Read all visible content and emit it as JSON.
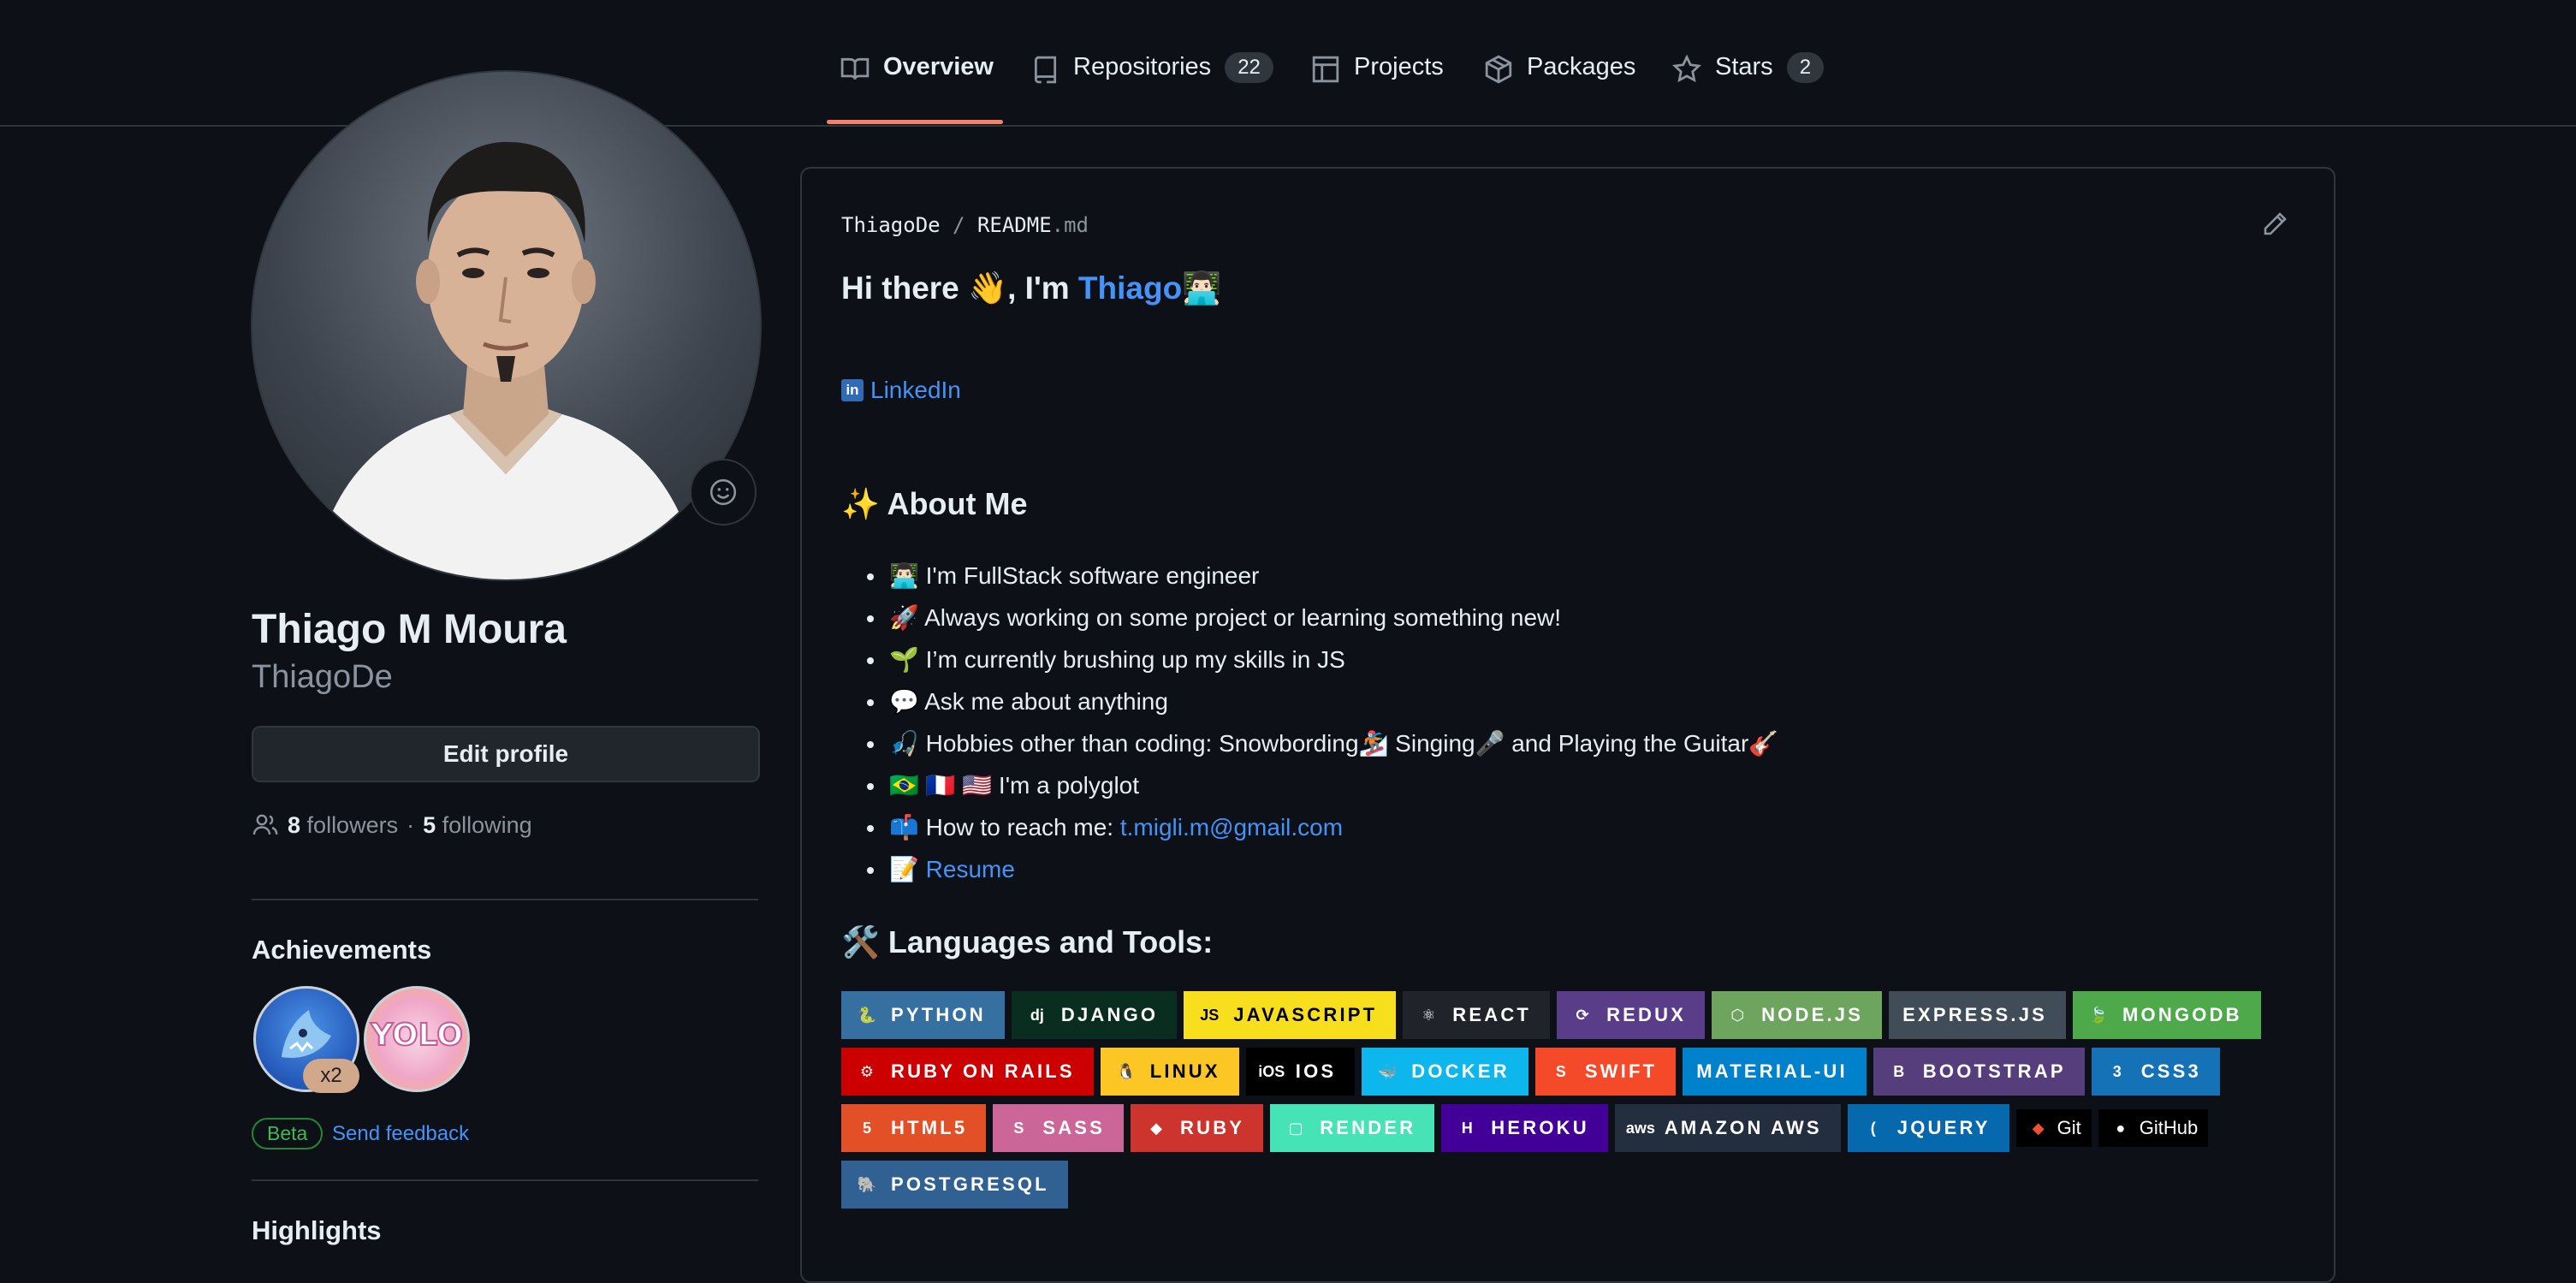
{
  "tabs": [
    {
      "label": "Overview",
      "icon": "book-icon",
      "active": true
    },
    {
      "label": "Repositories",
      "icon": "repo-icon",
      "count": "22"
    },
    {
      "label": "Projects",
      "icon": "table-icon"
    },
    {
      "label": "Packages",
      "icon": "package-icon"
    },
    {
      "label": "Stars",
      "icon": "star-icon",
      "count": "2"
    }
  ],
  "profile": {
    "fullname": "Thiago M Moura",
    "login": "ThiagoDe",
    "edit_label": "Edit profile",
    "followers_count": "8",
    "followers_label": "followers",
    "sep": "·",
    "following_count": "5",
    "following_label": "following"
  },
  "achievements": {
    "title": "Achievements",
    "multiplier": "x2",
    "beta_label": "Beta",
    "feedback_label": "Send feedback"
  },
  "highlights": {
    "title": "Highlights"
  },
  "readme": {
    "path_owner": "ThiagoDe",
    "path_sep": "/",
    "path_file": "README",
    "path_ext": ".md",
    "greeting_prefix": "Hi there 👋, I'm ",
    "greeting_name": "Thiago",
    "greeting_suffix": "👨🏻‍💻",
    "linkedin_label": "LinkedIn",
    "about_title": "✨ About Me",
    "about_items": [
      {
        "text": "👨🏻‍💻 I'm FullStack software engineer"
      },
      {
        "text": "🚀 Always working on some project or learning something new!"
      },
      {
        "text": "🌱 I’m currently brushing up my skills in JS"
      },
      {
        "text": "💬 Ask me about anything"
      },
      {
        "text": "🎣 Hobbies other than coding: Snowbording🏂 Singing🎤 and Playing the Guitar🎸"
      },
      {
        "text": "🇧🇷 🇫🇷 🇺🇸 I'm a polyglot"
      },
      {
        "text": "📫 How to reach me: ",
        "link": "t.migli.m@gmail.com"
      },
      {
        "text": "📝 ",
        "link": "Resume"
      }
    ],
    "tools_title": "🛠️ Languages and Tools:"
  },
  "shields": [
    [
      {
        "label": "PYTHON",
        "bg": "#3670a0",
        "icon": "python-icon",
        "glyph": "🐍"
      },
      {
        "label": "DJANGO",
        "bg": "#092e20",
        "icon": "django-icon",
        "glyph": "dj"
      },
      {
        "label": "JAVASCRIPT",
        "bg": "#f7df1e",
        "fg": "#000000",
        "icon": "javascript-icon",
        "glyph": "JS"
      },
      {
        "label": "REACT",
        "bg": "#20232a",
        "icon": "react-icon",
        "glyph": "⚛"
      },
      {
        "label": "REDUX",
        "bg": "#593d88",
        "icon": "redux-icon",
        "glyph": "⟳"
      },
      {
        "label": "NODE.JS",
        "bg": "#6da55f",
        "icon": "nodejs-icon",
        "glyph": "⬡"
      },
      {
        "label": "EXPRESS.JS",
        "bg": "#404d59",
        "icon": "",
        "glyph": ""
      },
      {
        "label": "MONGODB",
        "bg": "#4ea94b",
        "icon": "mongodb-icon",
        "glyph": "🍃"
      }
    ],
    [
      {
        "label": "RUBY ON RAILS",
        "bg": "#cc0000",
        "icon": "rails-icon",
        "glyph": "⚙"
      },
      {
        "label": "LINUX",
        "bg": "#fcc624",
        "fg": "#000000",
        "icon": "linux-icon",
        "glyph": "🐧"
      },
      {
        "label": "IOS",
        "bg": "#000000",
        "icon": "ios-icon",
        "glyph": "iOS"
      },
      {
        "label": "DOCKER",
        "bg": "#0db7ed",
        "icon": "docker-icon",
        "glyph": "🐳"
      },
      {
        "label": "SWIFT",
        "bg": "#f54a2a",
        "icon": "swift-icon",
        "glyph": "S"
      },
      {
        "label": "MATERIAL-UI",
        "bg": "#0081cb",
        "icon": "",
        "glyph": ""
      },
      {
        "label": "BOOTSTRAP",
        "bg": "#563d7c",
        "icon": "bootstrap-icon",
        "glyph": "B"
      },
      {
        "label": "CSS3",
        "bg": "#1572b6",
        "icon": "css3-icon",
        "glyph": "3"
      }
    ],
    [
      {
        "label": "HTML5",
        "bg": "#e34f26",
        "icon": "html5-icon",
        "glyph": "5"
      },
      {
        "label": "SASS",
        "bg": "#cc6699",
        "icon": "sass-icon",
        "glyph": "S"
      },
      {
        "label": "RUBY",
        "bg": "#cc342d",
        "icon": "ruby-icon",
        "glyph": "◆"
      },
      {
        "label": "RENDER",
        "bg": "#46e3b7",
        "icon": "render-icon",
        "glyph": "▢"
      },
      {
        "label": "HEROKU",
        "bg": "#430098",
        "icon": "heroku-icon",
        "glyph": "H"
      },
      {
        "label": "AMAZON AWS",
        "bg": "#232f3e",
        "icon": "aws-icon",
        "glyph": "aws"
      },
      {
        "label": "JQUERY",
        "bg": "#0769ad",
        "icon": "jquery-icon",
        "glyph": "("
      },
      {
        "label": "Git",
        "bg": "#000000",
        "icon": "git-icon",
        "glyph": "◆",
        "small": true,
        "iconcolor": "#f05032"
      },
      {
        "label": "GitHub",
        "bg": "#000000",
        "icon": "github-icon",
        "glyph": "●",
        "small": true
      }
    ],
    [
      {
        "label": "POSTGRESQL",
        "bg": "#316192",
        "icon": "postgresql-icon",
        "glyph": "🐘"
      }
    ]
  ],
  "colors": {
    "background": "#0d1117",
    "border": "#30363d",
    "link": "#4493f8",
    "tab_underline": "#f78166",
    "muted": "#8b949e"
  }
}
